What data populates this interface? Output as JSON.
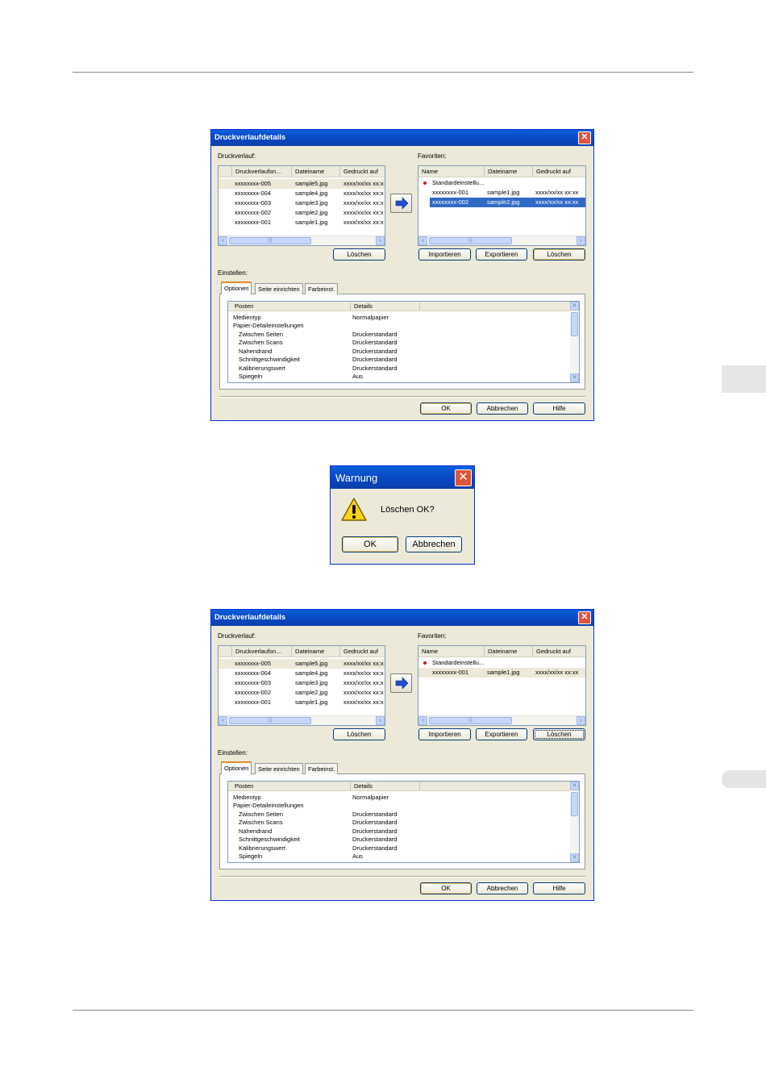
{
  "dialog1": {
    "title": "Druckverlaufdetails",
    "history_label": "Druckverlauf:",
    "favorites_label": "Favoriten:",
    "history_columns": [
      "Druckverlaufsn...",
      "Dateiname",
      "Gedruckt auf"
    ],
    "history_rows": [
      [
        "xxxxxxxx-005",
        "sample5.jpg",
        "xxxx/xx/xx xx:xx"
      ],
      [
        "xxxxxxxx-004",
        "sample4.jpg",
        "xxxx/xx/xx xx:xx"
      ],
      [
        "xxxxxxxx-003",
        "sample3.jpg",
        "xxxx/xx/xx xx:xx"
      ],
      [
        "xxxxxxxx-002",
        "sample2.jpg",
        "xxxx/xx/xx xx:xx"
      ],
      [
        "xxxxxxxx-001",
        "sample1.jpg",
        "xxxx/xx/xx xx:xx"
      ]
    ],
    "favorites_columns": [
      "Name",
      "Dateiname",
      "Gedruckt auf"
    ],
    "favorites_rows": [
      [
        "Standardeinstellu...",
        "",
        ""
      ],
      [
        "xxxxxxxx-001",
        "sample1.jpg",
        "xxxx/xx/xx xx:xx"
      ],
      [
        "xxxxxxxx-002",
        "sample2.jpg",
        "xxxx/xx/xx xx:xx"
      ]
    ],
    "history_delete": "Löschen",
    "import": "Importieren",
    "export": "Exportieren",
    "fav_delete": "Löschen",
    "settings_label": "Einstellen:",
    "tabs": [
      "Optionen",
      "Seite einrichten",
      "Farbeinst."
    ],
    "option_columns": [
      "Posten",
      "Details"
    ],
    "options": [
      [
        "Medientyp",
        "Normalpapier"
      ],
      [
        "Papier-Detaileinstellungen",
        ""
      ],
      [
        "Zwischen Seiten",
        "Druckerstandard"
      ],
      [
        "Zwischen Scans",
        "Druckerstandard"
      ],
      [
        "Nahendrand",
        "Druckerstandard"
      ],
      [
        "Schnittgeschwindigkeit",
        "Druckerstandard"
      ],
      [
        "Kalibrierungswert",
        "Druckerstandard"
      ],
      [
        "Spiegeln",
        "Aus"
      ]
    ],
    "ok": "OK",
    "cancel": "Abbrechen",
    "help": "Hilfe"
  },
  "warning": {
    "title": "Warnung",
    "message": "Löschen OK?",
    "ok": "OK",
    "cancel": "Abbrechen"
  },
  "dialog2": {
    "title": "Druckverlaufdetails",
    "history_label": "Druckverlauf:",
    "favorites_label": "Favoriten:",
    "history_columns": [
      "Druckverlaufsn...",
      "Dateiname",
      "Gedruckt auf"
    ],
    "history_rows": [
      [
        "xxxxxxxx-005",
        "sample5.jpg",
        "xxxx/xx/xx xx:xx"
      ],
      [
        "xxxxxxxx-004",
        "sample4.jpg",
        "xxxx/xx/xx xx:xx"
      ],
      [
        "xxxxxxxx-003",
        "sample3.jpg",
        "xxxx/xx/xx xx:xx"
      ],
      [
        "xxxxxxxx-002",
        "sample2.jpg",
        "xxxx/xx/xx xx:xx"
      ],
      [
        "xxxxxxxx-001",
        "sample1.jpg",
        "xxxx/xx/xx xx:xx"
      ]
    ],
    "favorites_columns": [
      "Name",
      "Dateiname",
      "Gedruckt auf"
    ],
    "favorites_rows": [
      [
        "Standardeinstellu...",
        "",
        ""
      ],
      [
        "xxxxxxxx-001",
        "sample1.jpg",
        "xxxx/xx/xx xx:xx"
      ]
    ],
    "history_delete": "Löschen",
    "import": "Importieren",
    "export": "Exportieren",
    "fav_delete": "Löschen",
    "settings_label": "Einstellen:",
    "tabs": [
      "Optionen",
      "Seite einrichten",
      "Farbeinst."
    ],
    "option_columns": [
      "Posten",
      "Details"
    ],
    "options": [
      [
        "Medientyp",
        "Normalpapier"
      ],
      [
        "Papier-Detaileinstellungen",
        ""
      ],
      [
        "Zwischen Seiten",
        "Druckerstandard"
      ],
      [
        "Zwischen Scans",
        "Druckerstandard"
      ],
      [
        "Nahendrand",
        "Druckerstandard"
      ],
      [
        "Schnittgeschwindigkeit",
        "Druckerstandard"
      ],
      [
        "Kalibrierungswert",
        "Druckerstandard"
      ],
      [
        "Spiegeln",
        "Aus"
      ]
    ],
    "ok": "OK",
    "cancel": "Abbrechen",
    "help": "Hilfe"
  }
}
